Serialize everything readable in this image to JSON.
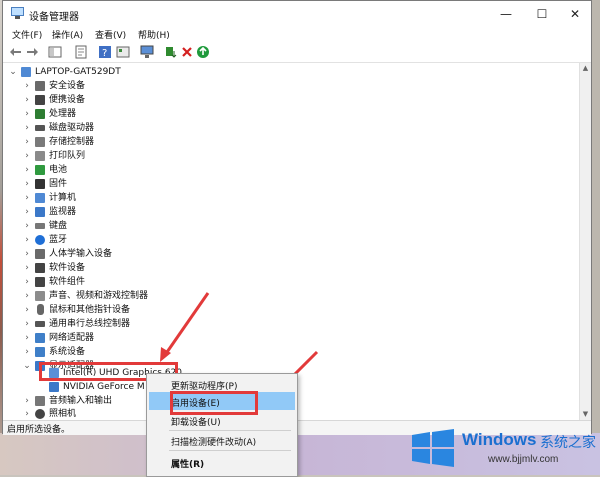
{
  "window": {
    "title": "设备管理器",
    "controls": {
      "minimize": "—",
      "maximize": "☐",
      "close": "✕"
    }
  },
  "menu": [
    "文件(F)",
    "操作(A)",
    "查看(V)",
    "帮助(H)"
  ],
  "tree": {
    "root": "LAPTOP-GAT529DT",
    "items": [
      "安全设备",
      "便携设备",
      "处理器",
      "磁盘驱动器",
      "存储控制器",
      "打印队列",
      "电池",
      "固件",
      "计算机",
      "监视器",
      "键盘",
      "蓝牙",
      "人体学输入设备",
      "软件设备",
      "软件组件",
      "声音、视频和游戏控制器",
      "鼠标和其他指针设备",
      "通用串行总线控制器",
      "网络适配器",
      "系统设备",
      "显示适配器"
    ],
    "display_children": [
      "Intel(R) UHD Graphics 620",
      "NVIDIA GeForce M"
    ],
    "after_items": [
      "音频输入和输出",
      "照相机"
    ]
  },
  "context_menu": [
    "更新驱动程序(P)",
    "启用设备(E)",
    "卸载设备(U)",
    "扫描检测硬件改动(A)",
    "属性(R)"
  ],
  "status": "启用所选设备。",
  "watermark": {
    "brand": "Windows",
    "cn": "系统之家",
    "url": "www.bjjmlv.com"
  },
  "colors": {
    "accent": "#e23a3a",
    "highlight": "#91c9f7",
    "brand": "#1a6fd0"
  }
}
